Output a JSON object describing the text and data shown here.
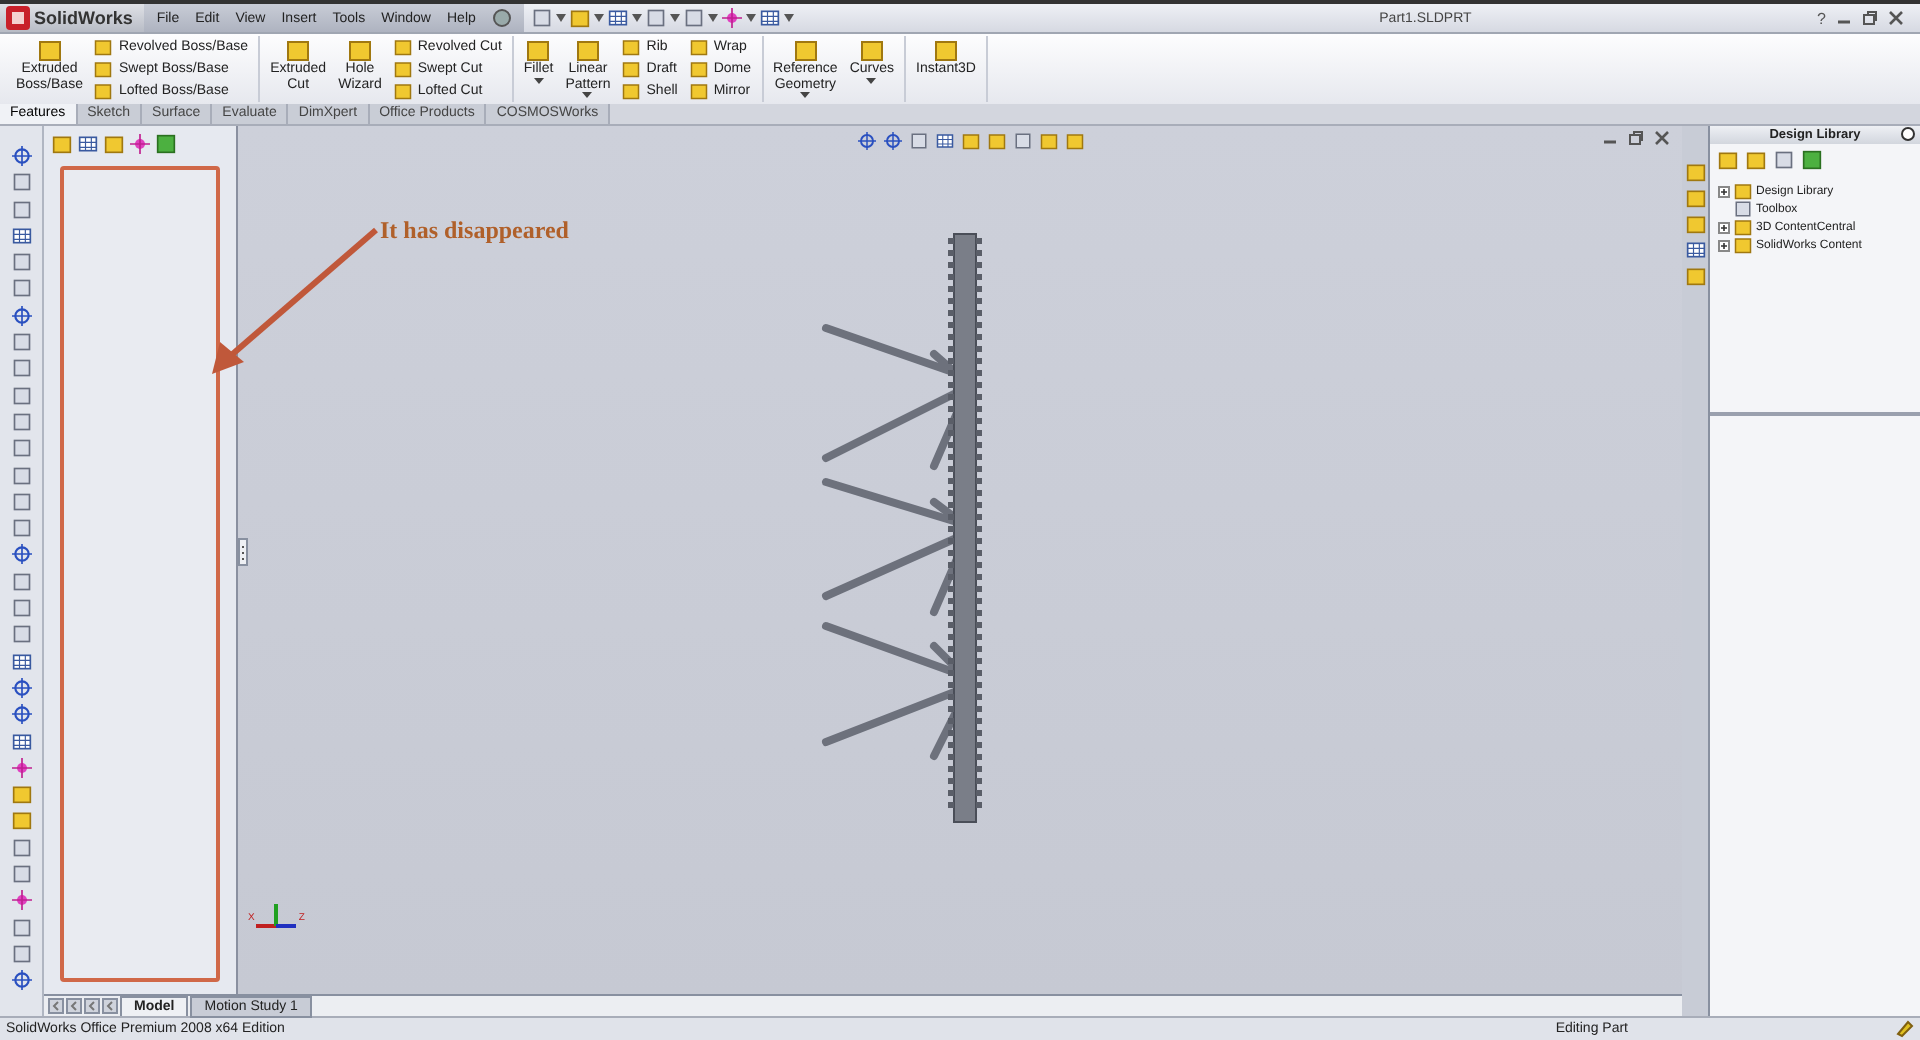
{
  "app_logo": "SolidWorks",
  "menu": [
    "File",
    "Edit",
    "View",
    "Insert",
    "Tools",
    "Window",
    "Help"
  ],
  "document_title": "Part1.SLDPRT",
  "help_button": "?",
  "ribbon": [
    [
      {
        "kind": "large",
        "label": "Extruded Boss/Base",
        "menu": false
      },
      {
        "kind": "stack",
        "items": [
          "Revolved Boss/Base",
          "Swept Boss/Base",
          "Lofted Boss/Base"
        ]
      }
    ],
    [
      {
        "kind": "large",
        "label": "Extruded Cut",
        "menu": false
      },
      {
        "kind": "large",
        "label": "Hole Wizard",
        "menu": false
      },
      {
        "kind": "stack",
        "items": [
          "Revolved Cut",
          "Swept Cut",
          "Lofted Cut"
        ]
      }
    ],
    [
      {
        "kind": "large",
        "label": "Fillet",
        "menu": true
      },
      {
        "kind": "large",
        "label": "Linear Pattern",
        "menu": true
      },
      {
        "kind": "stack",
        "items": [
          "Rib",
          "Draft",
          "Shell"
        ]
      },
      {
        "kind": "stack",
        "items": [
          "Wrap",
          "Dome",
          "Mirror"
        ]
      }
    ],
    [
      {
        "kind": "large",
        "label": "Reference Geometry",
        "menu": true
      },
      {
        "kind": "large",
        "label": "Curves",
        "menu": true
      }
    ],
    [
      {
        "kind": "large",
        "label": "Instant3D",
        "menu": false
      }
    ]
  ],
  "command_tabs": [
    {
      "label": "Features",
      "selected": true
    },
    {
      "label": "Sketch",
      "selected": false
    },
    {
      "label": "Surface",
      "selected": false
    },
    {
      "label": "Evaluate",
      "selected": false
    },
    {
      "label": "DimXpert",
      "selected": false
    },
    {
      "label": "Office Products",
      "selected": false
    },
    {
      "label": "COSMOSWorks",
      "selected": false
    }
  ],
  "annotation": {
    "text": "It has disappeared"
  },
  "axis_labels": [
    "X",
    "Z"
  ],
  "design_library": {
    "title": "Design Library",
    "tree": [
      {
        "label": "Design Library",
        "kind": "folder"
      },
      {
        "label": "Toolbox",
        "kind": "leaf"
      },
      {
        "label": "3D ContentCentral",
        "kind": "folder"
      },
      {
        "label": "SolidWorks Content",
        "kind": "folder"
      }
    ]
  },
  "bottom_tabs": [
    {
      "label": "Model",
      "selected": true
    },
    {
      "label": "Motion Study 1",
      "selected": false
    }
  ],
  "status_bar": {
    "left": "SolidWorks Office Premium 2008 x64 Edition",
    "right": "Editing Part"
  }
}
